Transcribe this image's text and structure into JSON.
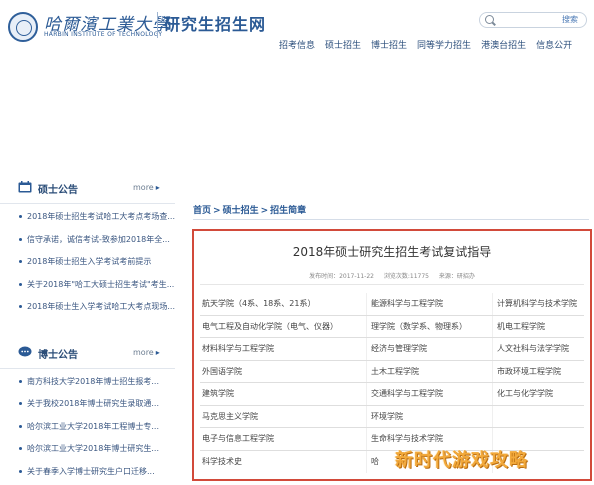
{
  "header": {
    "logo_cn": "哈爾濱工業大學",
    "logo_en": "HARBIN INSTITUTE OF TECHNOLOGY",
    "site_title": "研究生招生网",
    "search": {
      "button_label": "搜索",
      "placeholder": ""
    }
  },
  "nav": {
    "items": [
      "招考信息",
      "硕士招生",
      "博士招生",
      "同等学力招生",
      "港澳台招生",
      "信息公开"
    ]
  },
  "sidebar": {
    "master": {
      "title": "硕士公告",
      "more_label": "more",
      "items": [
        "2018年硕士招生考试哈工大考点考场查...",
        "信守承诺，诚信考试-致参加2018年全...",
        "2018年硕士招生入学考试考前提示",
        "关于2018年\"哈工大硕士招生考试\"考生...",
        "2018年硕士生入学考试哈工大考点现场..."
      ]
    },
    "doctor": {
      "title": "博士公告",
      "more_label": "more",
      "items": [
        "南方科技大学2018年博士招生报考...",
        "关于我校2018年博士研究生录取通...",
        "哈尔滨工业大学2018年工程博士专...",
        "哈尔滨工业大学2018年博士研究生...",
        "关于春季入学博士研究生户口迁移..."
      ]
    }
  },
  "breadcrumb": [
    "首页",
    "硕士招生",
    "招生简章"
  ],
  "article": {
    "title": "2018年硕士研究生招生考试复试指导",
    "meta": {
      "date": "发布时间：2017-11-22",
      "views": "浏览次数:11775",
      "source": "来源：研招办"
    },
    "rows": [
      [
        "航天学院（4系、18系、21系）",
        "能源科学与工程学院",
        "计算机科学与技术学院"
      ],
      [
        "电气工程及自动化学院（电气、仪器）",
        "理学院（数学系、物理系）",
        "机电工程学院"
      ],
      [
        "材料科学与工程学院",
        "经济与管理学院",
        "人文社科与法学学院"
      ],
      [
        "外国语学院",
        "土木工程学院",
        "市政环境工程学院"
      ],
      [
        "建筑学院",
        "交通科学与工程学院",
        "化工与化学学院"
      ],
      [
        "马克思主义学院",
        "环境学院",
        ""
      ],
      [
        "电子与信息工程学院",
        "生命科学与技术学院",
        ""
      ],
      [
        "科学技术史",
        "哈",
        ""
      ]
    ]
  },
  "watermark": "新时代游戏攻略",
  "colors": {
    "brand_blue": "#2b5a95",
    "highlight_red": "#d24a3a",
    "watermark_orange": "#f2a93b"
  }
}
